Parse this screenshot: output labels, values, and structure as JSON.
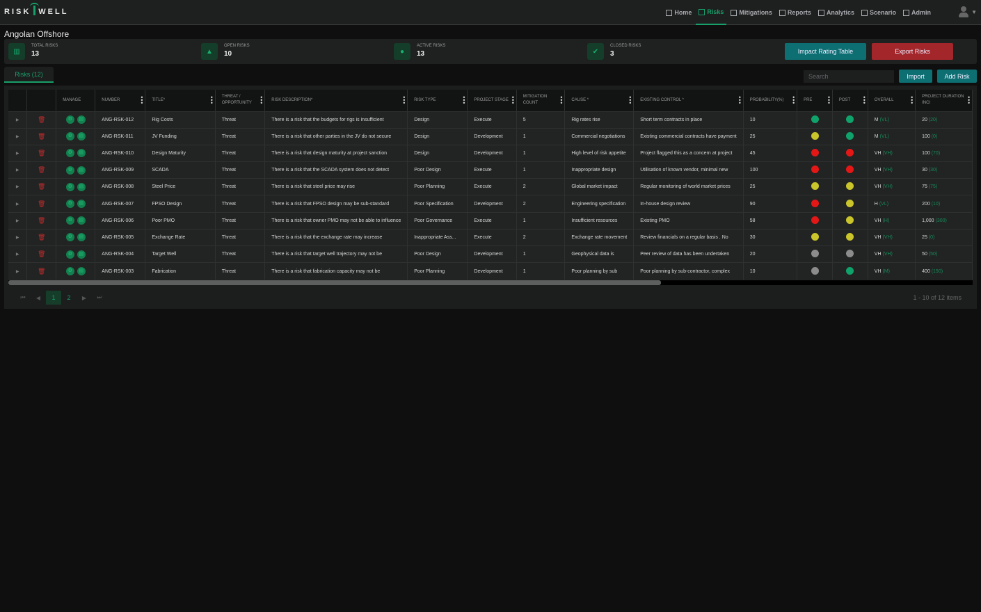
{
  "app": {
    "logo_left": "RISK",
    "logo_right": "WELL"
  },
  "nav": [
    {
      "label": "Home",
      "icon": "home-icon"
    },
    {
      "label": "Risks",
      "icon": "sitemap-icon",
      "active": true
    },
    {
      "label": "Mitigations",
      "icon": "document-icon"
    },
    {
      "label": "Reports",
      "icon": "grid-icon"
    },
    {
      "label": "Analytics",
      "icon": "document-icon"
    },
    {
      "label": "Scenario",
      "icon": "document-icon"
    },
    {
      "label": "Admin",
      "icon": "document-icon"
    }
  ],
  "page": {
    "title": "Angolan Offshore"
  },
  "stats": [
    {
      "label": "TOTAL RISKS",
      "value": "13",
      "icon": "bar-chart-icon"
    },
    {
      "label": "OPEN RISKS",
      "value": "10",
      "icon": "triangle-icon"
    },
    {
      "label": "ACTIVE RISKS",
      "value": "13",
      "icon": "info-icon"
    },
    {
      "label": "CLOSED RISKS",
      "value": "3",
      "icon": "check-circle-icon"
    }
  ],
  "buttons": {
    "impact": "Impact Rating Table",
    "export": "Export Risks",
    "import": "Import",
    "add": "Add Risk"
  },
  "colors": {
    "accent": "#17a06a",
    "impact": "#0e6f73",
    "export": "#a3262a",
    "green": "#0fa36b",
    "yellow": "#c9c52b",
    "red": "#e41717",
    "gray": "#8c8c8c"
  },
  "tab": {
    "label": "Risks (12)"
  },
  "search": {
    "placeholder": "Search",
    "value": ""
  },
  "table": {
    "columns": [
      "",
      "",
      "MANAGE",
      "NUMBER",
      "TITLE*",
      "THREAT / OPPORTUNITY",
      "RISK DESCRIPTION*",
      "RISK TYPE",
      "PROJECT STAGE",
      "MITIGATION COUNT",
      "CAUSE *",
      "EXISTING CONTROL *",
      "PROBABILITY(%)",
      "PRE",
      "POST",
      "OVERALL",
      "PROJECT DURATION INCI"
    ],
    "rows": [
      {
        "number": "ANG-RSK-012",
        "title": "Rig Costs",
        "threat": "Threat",
        "desc": "There is a risk that the budgets for rigs is insufficient",
        "type": "Design",
        "stage": "Execute",
        "mit": "5",
        "cause": "Rig rates rise",
        "control": "Short term contracts in place",
        "prob": "10",
        "pre": "green",
        "post": "green",
        "overall": "M",
        "overall_post": "(VL)",
        "dur": "20",
        "dur_post": "(20)"
      },
      {
        "number": "ANG-RSK-011",
        "title": "JV Funding",
        "threat": "Threat",
        "desc": "There is a risk that other parties in the JV do not secure",
        "type": "Design",
        "stage": "Development",
        "mit": "1",
        "cause": "Commercial negotiations",
        "control": "Existing commercial contracts have payment",
        "prob": "25",
        "pre": "yellow",
        "post": "green",
        "overall": "M",
        "overall_post": "(VL)",
        "dur": "100",
        "dur_post": "(0)"
      },
      {
        "number": "ANG-RSK-010",
        "title": "Design Maturity",
        "threat": "Threat",
        "desc": "There is a risk that design maturity at project sanction",
        "type": "Design",
        "stage": "Development",
        "mit": "1",
        "cause": "High level of risk appetite",
        "control": "Project flagged this as a concern at project",
        "prob": "45",
        "pre": "red",
        "post": "red",
        "overall": "VH",
        "overall_post": "(VH)",
        "dur": "100",
        "dur_post": "(70)"
      },
      {
        "number": "ANG-RSK-009",
        "title": "SCADA",
        "threat": "Threat",
        "desc": "There is a risk that the SCADA system does not detect",
        "type": "Poor Design",
        "stage": "Execute",
        "mit": "1",
        "cause": "Inappropriate design",
        "control": "Utilisation of known vendor, minimal new",
        "prob": "100",
        "pre": "red",
        "post": "red",
        "overall": "VH",
        "overall_post": "(VH)",
        "dur": "30",
        "dur_post": "(30)"
      },
      {
        "number": "ANG-RSK-008",
        "title": "Steel Price",
        "threat": "Threat",
        "desc": "There is a risk that steel price may rise",
        "type": "Poor Planning",
        "stage": "Execute",
        "mit": "2",
        "cause": "Global market impact",
        "control": "Regular monitoring of world market prices",
        "prob": "25",
        "pre": "yellow",
        "post": "yellow",
        "overall": "VH",
        "overall_post": "(VH)",
        "dur": "75",
        "dur_post": "(75)"
      },
      {
        "number": "ANG-RSK-007",
        "title": "FPSO Design",
        "threat": "Threat",
        "desc": "There is a risk that FPSO design may be sub-standard",
        "type": "Poor Specification",
        "stage": "Development",
        "mit": "2",
        "cause": "Engineering specification",
        "control": "In-house design review",
        "prob": "90",
        "pre": "red",
        "post": "yellow",
        "overall": "H",
        "overall_post": "(VL)",
        "dur": "200",
        "dur_post": "(10)"
      },
      {
        "number": "ANG-RSK-006",
        "title": "Poor PMO",
        "threat": "Threat",
        "desc": "There is a risk that owner PMO may not be able to influence",
        "type": "Poor Governance",
        "stage": "Execute",
        "mit": "1",
        "cause": "Insufficient resources",
        "control": "Existing PMO",
        "prob": "58",
        "pre": "red",
        "post": "yellow",
        "overall": "VH",
        "overall_post": "(H)",
        "dur": "1,000",
        "dur_post": "(300)"
      },
      {
        "number": "ANG-RSK-005",
        "title": "Exchange Rate",
        "threat": "Threat",
        "desc": "There is a risk that the exchange rate may increase",
        "type": "Inappropriate Ass...",
        "stage": "Execute",
        "mit": "2",
        "cause": "Exchange rate movement",
        "control": "Review financials on a regular basis . No",
        "prob": "30",
        "pre": "yellow",
        "post": "yellow",
        "overall": "VH",
        "overall_post": "(VH)",
        "dur": "25",
        "dur_post": "(0)"
      },
      {
        "number": "ANG-RSK-004",
        "title": "Target Well",
        "threat": "Threat",
        "desc": "There is a risk that target well trajectory may not be",
        "type": "Poor Design",
        "stage": "Development",
        "mit": "1",
        "cause": "Geophysical data is",
        "control": "Peer review of data has been undertaken",
        "prob": "20",
        "pre": "gray",
        "post": "gray",
        "overall": "VH",
        "overall_post": "(VH)",
        "dur": "50",
        "dur_post": "(50)"
      },
      {
        "number": "ANG-RSK-003",
        "title": "Fabrication",
        "threat": "Threat",
        "desc": "There is a risk that fabrication capacity may not be",
        "type": "Poor Planning",
        "stage": "Development",
        "mit": "1",
        "cause": "Poor planning by sub",
        "control": "Poor planning by sub-contractor, complex",
        "prob": "10",
        "pre": "gray",
        "post": "green",
        "overall": "VH",
        "overall_post": "(M)",
        "dur": "400",
        "dur_post": "(150)"
      }
    ]
  },
  "pagination": {
    "pages": [
      "1",
      "2"
    ],
    "current": "1",
    "summary": "1 - 10 of 12 items"
  }
}
